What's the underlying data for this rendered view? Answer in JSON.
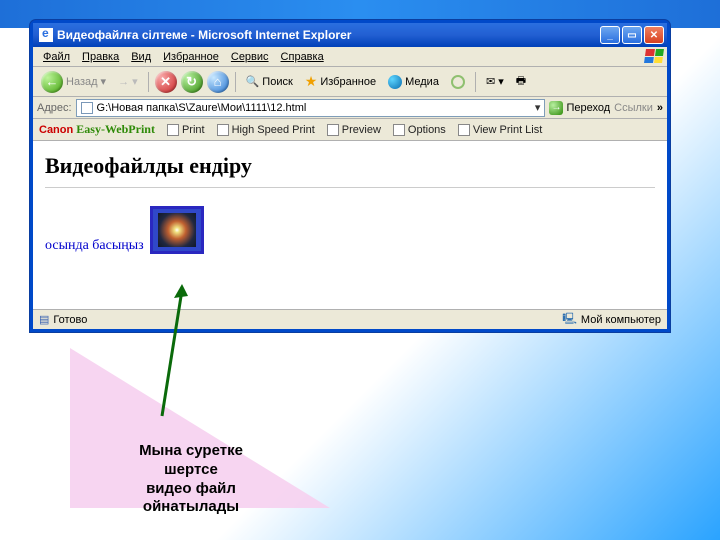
{
  "window": {
    "title": "Видеофайлға сілтеме - Microsoft Internet Explorer"
  },
  "menu": {
    "file": "Файл",
    "edit": "Правка",
    "view": "Вид",
    "favorites": "Избранное",
    "tools": "Сервис",
    "help": "Справка"
  },
  "toolbar": {
    "back": "Назад",
    "search": "Поиск",
    "favorites": "Избранное",
    "media": "Медиа"
  },
  "address": {
    "label": "Адрес:",
    "value": "G:\\Новая папка\\S\\Zaure\\Мои\\1111\\12.html",
    "go": "Переход",
    "links": "Ссылки"
  },
  "canon": {
    "brand_c": "Canon",
    "brand_e": "Easy-WebPrint",
    "print": "Print",
    "hsp": "High Speed Print",
    "preview": "Preview",
    "options": "Options",
    "vpl": "View Print List"
  },
  "page": {
    "heading": "Видеофайлды ендіру",
    "link_text": "осында басыңыз"
  },
  "status": {
    "ready": "Готово",
    "zone": "Мой компьютер"
  },
  "caption": {
    "line1": "Мына суретке",
    "line2": "шертсе",
    "line3": "видео файл",
    "line4": "ойнатылады"
  }
}
